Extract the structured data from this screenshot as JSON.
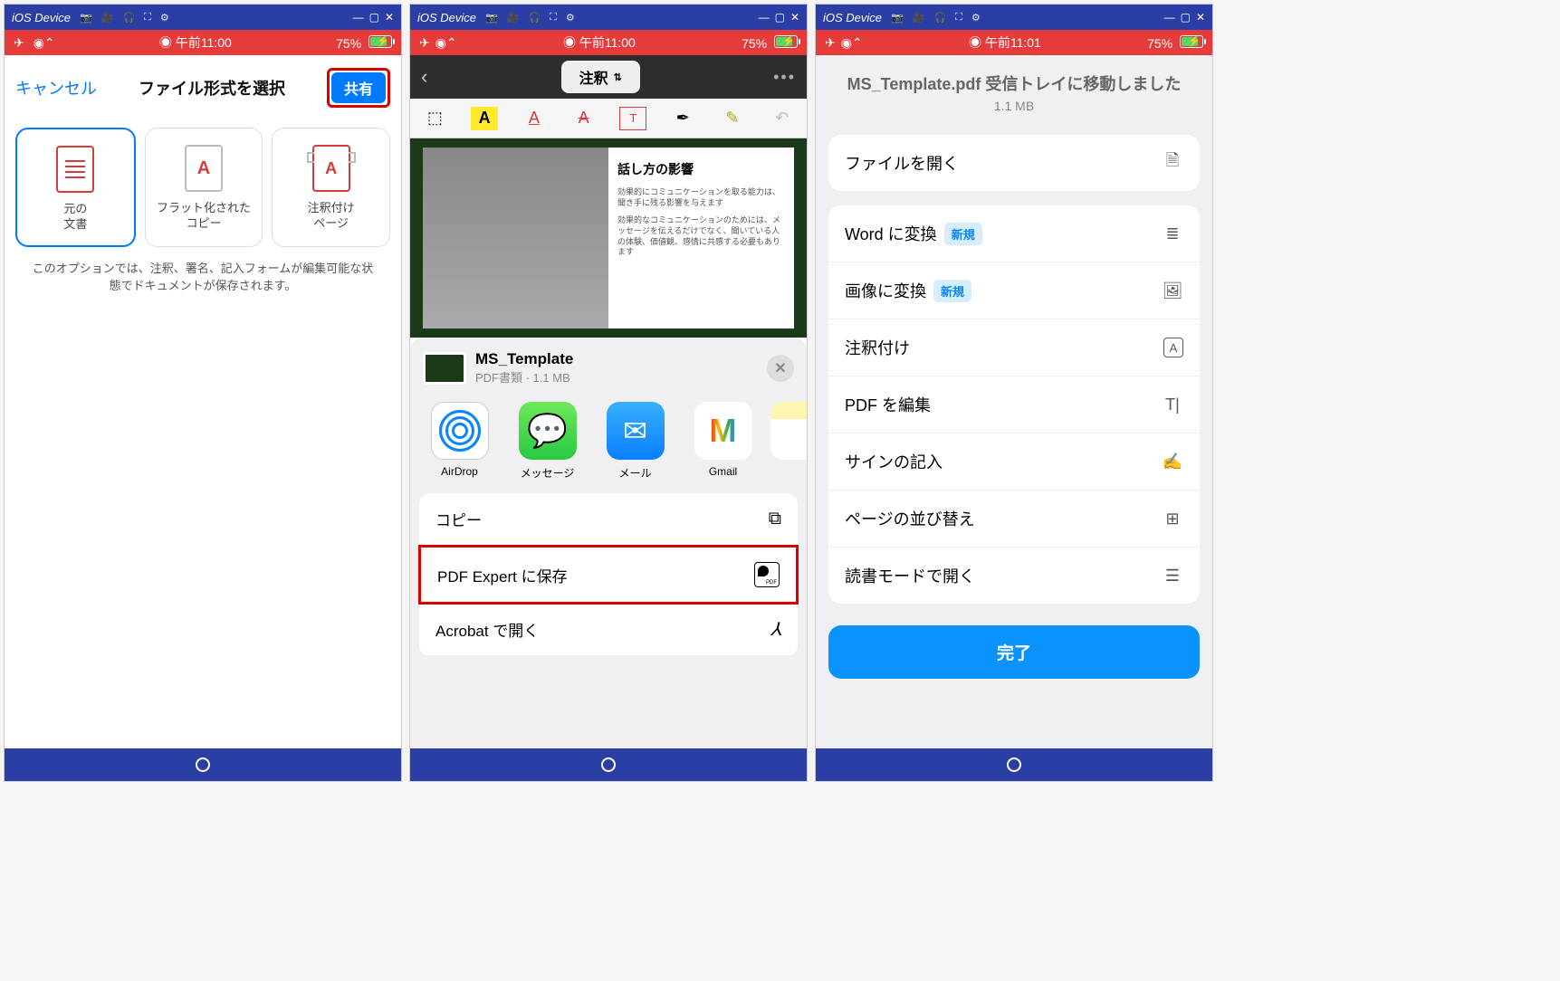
{
  "emubar": {
    "title": "iOS Device",
    "minimize": "—",
    "maximize": "▢",
    "close": "✕"
  },
  "status": {
    "time1": "午前11:00",
    "time2": "午前11:00",
    "time3": "午前11:01",
    "battery": "75%",
    "rec": "◉"
  },
  "screen1": {
    "cancel": "キャンセル",
    "title": "ファイル形式を選択",
    "share": "共有",
    "options": [
      {
        "line1": "元の",
        "line2": "文書"
      },
      {
        "line1": "フラット化された",
        "line2": "コピー"
      },
      {
        "line1": "注釈付け",
        "line2": "ページ"
      }
    ],
    "hint": "このオプションでは、注釈、署名、記入フォームが編集可能な状態でドキュメントが保存されます。"
  },
  "screen2": {
    "dropdown": "注釈",
    "doc": {
      "heading": "話し方の影響",
      "p1": "効果的にコミュニケーションを取る能力は、聞き手に残る影響を与えます",
      "p2": "効果的なコミュニケーションのためには、メッセージを伝えるだけでなく、聞いている人の体験、価値観、感情に共感する必要もあります"
    },
    "file": {
      "name": "MS_Template",
      "meta": "PDF書類 · 1.1 MB"
    },
    "apps": [
      {
        "label": "AirDrop"
      },
      {
        "label": "メッセージ"
      },
      {
        "label": "メール"
      },
      {
        "label": "Gmail"
      }
    ],
    "actions": {
      "copy": "コピー",
      "savePdfExpert": "PDF Expert に保存",
      "openAcrobat": "Acrobat で開く"
    }
  },
  "screen3": {
    "title": "MS_Template.pdf 受信トレイに移動しました",
    "size": "1.1 MB",
    "open": "ファイルを開く",
    "rows": [
      {
        "label": "Word に変換",
        "badge": "新規"
      },
      {
        "label": "画像に変換",
        "badge": "新規"
      },
      {
        "label": "注釈付け",
        "badge": ""
      },
      {
        "label": "PDF を編集",
        "badge": ""
      },
      {
        "label": "サインの記入",
        "badge": ""
      },
      {
        "label": "ページの並び替え",
        "badge": ""
      },
      {
        "label": "読書モードで開く",
        "badge": ""
      }
    ],
    "done": "完了"
  }
}
